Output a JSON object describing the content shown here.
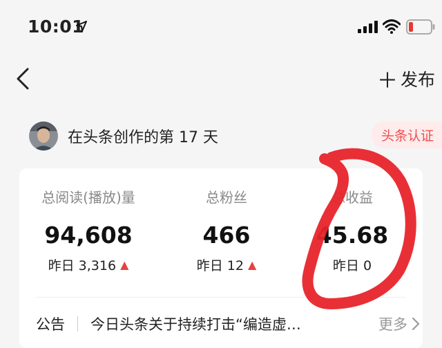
{
  "status_bar": {
    "time": "10:01",
    "icons": [
      "location-arrow-icon",
      "signal-icon",
      "wifi-icon",
      "battery-low-icon"
    ],
    "battery_color": "#e53935"
  },
  "nav": {
    "back_icon": "chevron-left-icon",
    "publish_label": "发布",
    "publish_icon": "plus-icon"
  },
  "profile": {
    "creator_days": "在头条创作的第 17 天",
    "badge": "头条认证"
  },
  "stats": [
    {
      "label": "总阅读(播放)量",
      "value": "94,608",
      "yesterday": "昨日 3,316",
      "trend": "up"
    },
    {
      "label": "总粉丝",
      "value": "466",
      "yesterday": "昨日 12",
      "trend": "up"
    },
    {
      "label": "总收益",
      "value": "45.68",
      "yesterday": "昨日 0",
      "trend": "none"
    }
  ],
  "notice": {
    "label": "公告",
    "text": "今日头条关于持续打击“编造虚…",
    "more": "更多"
  },
  "colors": {
    "accent_red": "#e54343",
    "badge_bg": "#fdeceb",
    "annotation_red": "#e8242b"
  }
}
